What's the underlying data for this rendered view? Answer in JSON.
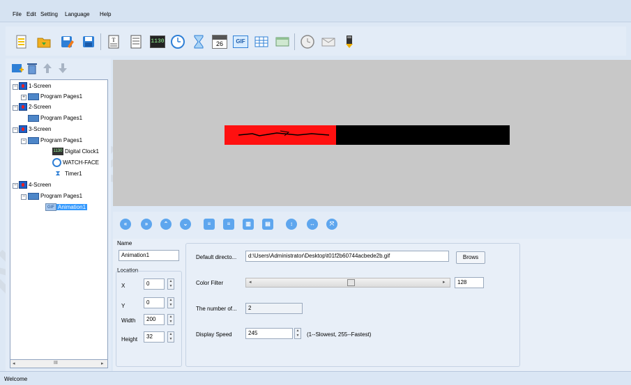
{
  "menu": [
    "File",
    "Edit",
    "Setting",
    "Language",
    "Help"
  ],
  "toolbar": {
    "icons": [
      "new-file-icon",
      "open-folder-icon",
      "save-as-icon",
      "save-icon",
      "text-icon",
      "document-icon",
      "digital-clock-icon",
      "analog-clock-icon",
      "hourglass-icon",
      "calendar-icon",
      "gif-icon",
      "table-icon",
      "window-icon",
      "settings-clock-icon",
      "mail-icon",
      "usb-download-icon"
    ],
    "digital_clock_label": "1130",
    "calendar_label": "26",
    "gif_label": "GIF"
  },
  "tree": {
    "items": [
      {
        "label": "1-Screen",
        "level": 0,
        "type": "screen"
      },
      {
        "label": "Program Pages1",
        "level": 1,
        "type": "program"
      },
      {
        "label": "2-Screen",
        "level": 0,
        "type": "screen"
      },
      {
        "label": "Program Pages1",
        "level": 1,
        "type": "program"
      },
      {
        "label": "3-Screen",
        "level": 0,
        "type": "screen"
      },
      {
        "label": "Program Pages1",
        "level": 1,
        "type": "program"
      },
      {
        "label": "Digital Clock1",
        "level": 2,
        "type": "digital-clock"
      },
      {
        "label": "WATCH-FACE",
        "level": 2,
        "type": "watch"
      },
      {
        "label": "Timer1",
        "level": 2,
        "type": "timer"
      },
      {
        "label": "4-Screen",
        "level": 0,
        "type": "screen"
      },
      {
        "label": "Program Pages1",
        "level": 1,
        "type": "program"
      },
      {
        "label": "Animation1",
        "level": 2,
        "type": "gif",
        "selected": true
      }
    ],
    "clock_icon_text": "1130",
    "gif_icon_text": "GIF",
    "scroll_mark": "III"
  },
  "props": {
    "name_label": "Name",
    "name_value": "Animation1",
    "location_label": "Location",
    "x_label": "X",
    "x_value": "0",
    "y_label": "Y",
    "y_value": "0",
    "width_label": "Width",
    "width_value": "200",
    "height_label": "Height",
    "height_value": "32",
    "dir_label": "Default directo...",
    "dir_value": "d:\\Users\\Administrator\\Desktop\\t01f2b60744acbede2b.gif",
    "browse_label": "Brows",
    "color_filter_label": "Color Filter",
    "color_filter_value": "128",
    "color_filter_level": 0.5,
    "frames_label": "The number of...",
    "frames_value": "2",
    "speed_label": "Display Speed",
    "speed_value": "245",
    "speed_hint": "(1--Slowest, 255--Fastest)"
  },
  "status": {
    "text": "Welcome"
  },
  "colors": {
    "accent": "#3399ff",
    "led_red": "#ff1010",
    "led_black": "#000000",
    "canvas_bg": "#c8c8c8"
  }
}
